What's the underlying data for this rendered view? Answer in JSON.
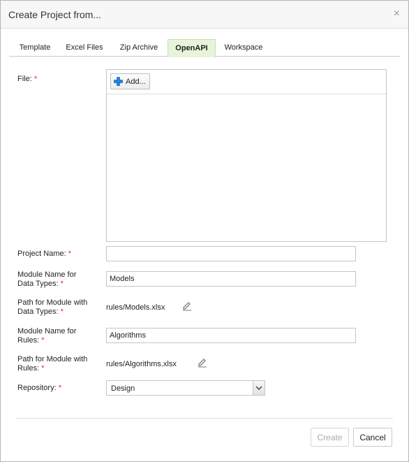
{
  "dialog": {
    "title": "Create Project from...",
    "close_glyph": "×"
  },
  "tabs": [
    {
      "label": "Template",
      "active": false
    },
    {
      "label": "Excel Files",
      "active": false
    },
    {
      "label": "Zip Archive",
      "active": false
    },
    {
      "label": "OpenAPI",
      "active": true
    },
    {
      "label": "Workspace",
      "active": false
    }
  ],
  "form": {
    "required_mark": "*",
    "file_label": "File:",
    "add_button_label": "Add...",
    "project_name_label": "Project Name:",
    "project_name_value": "",
    "module_data_types_label_1": "Module Name for",
    "module_data_types_label_2": "Data Types:",
    "module_data_types_value": "Models",
    "path_data_types_label_1": "Path for Module with",
    "path_data_types_label_2": "Data Types:",
    "path_data_types_value": "rules/Models.xlsx",
    "module_rules_label_1": "Module Name for",
    "module_rules_label_2": "Rules:",
    "module_rules_value": "Algorithms",
    "path_rules_label_1": "Path for Module with",
    "path_rules_label_2": "Rules:",
    "path_rules_value": "rules/Algorithms.xlsx",
    "repository_label": "Repository:",
    "repository_value": "Design"
  },
  "footer": {
    "create_label": "Create",
    "create_enabled": false,
    "cancel_label": "Cancel"
  },
  "colors": {
    "active_tab_bg": "#e8f4d9",
    "required": "#e22222",
    "add_icon": "#2f7fd1"
  },
  "icons": [
    "close-icon",
    "plus-icon",
    "pencil-icon",
    "chevron-down-icon"
  ]
}
